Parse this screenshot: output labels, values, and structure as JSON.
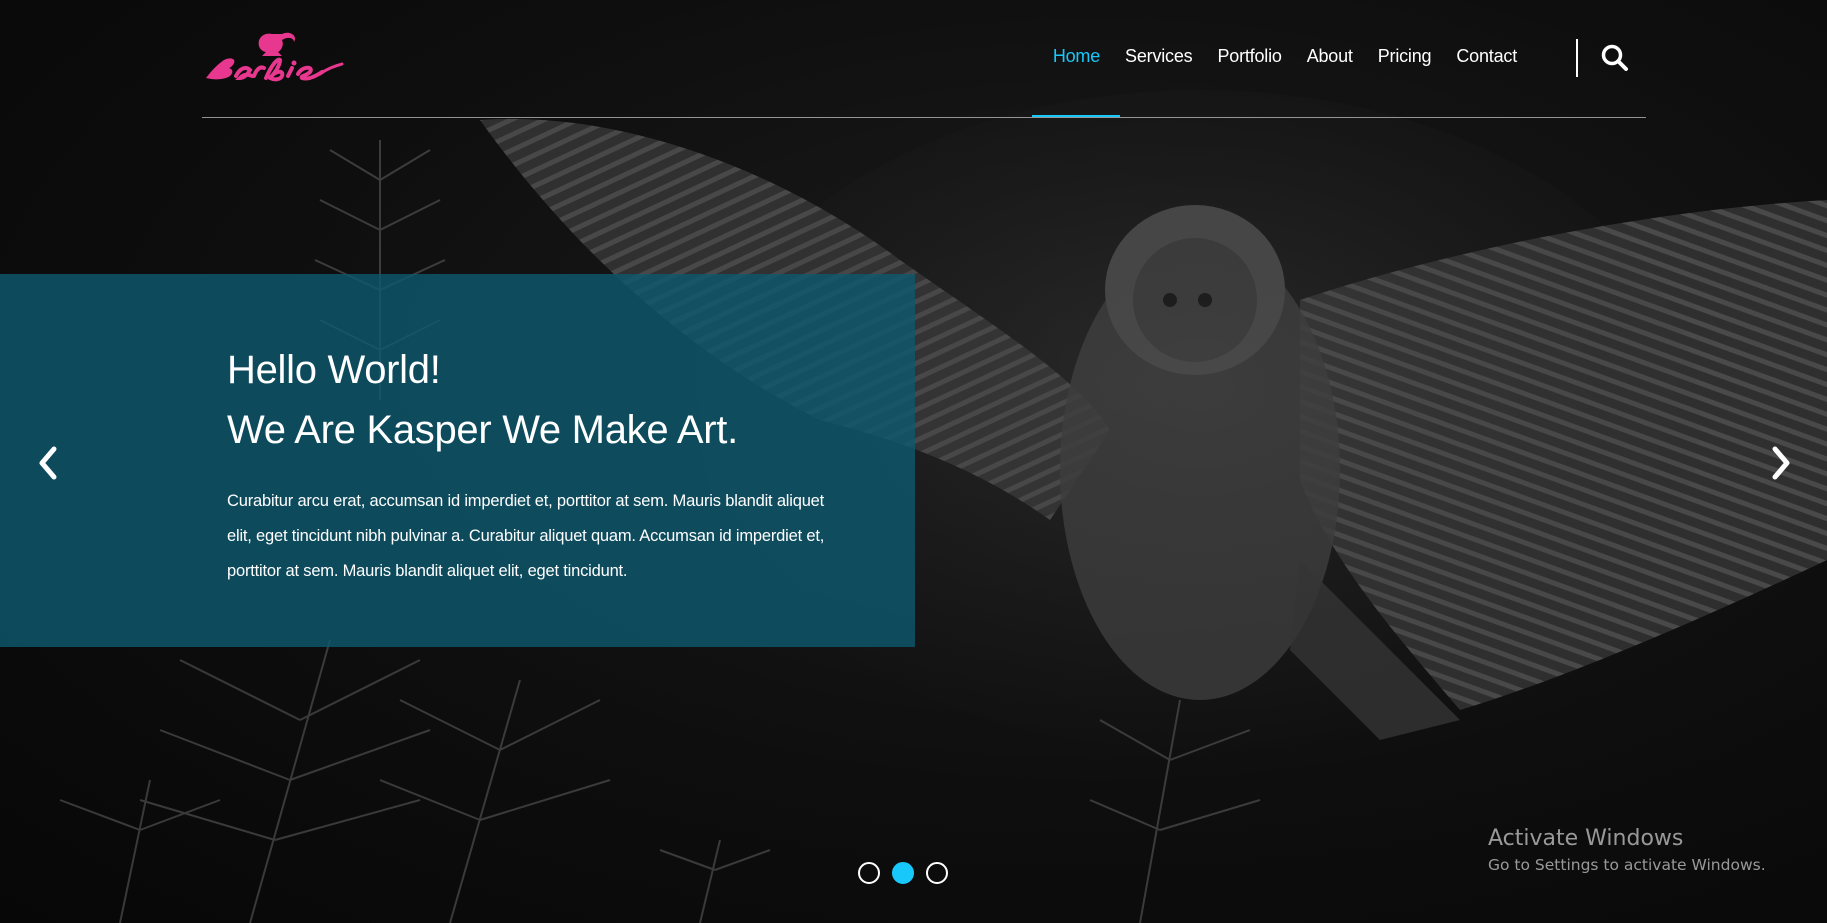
{
  "brand": {
    "logo_text": "Barbie",
    "logo_color": "#e8378f"
  },
  "nav": {
    "items": [
      {
        "label": "Home",
        "active": true
      },
      {
        "label": "Services",
        "active": false
      },
      {
        "label": "Portfolio",
        "active": false
      },
      {
        "label": "About",
        "active": false
      },
      {
        "label": "Pricing",
        "active": false
      },
      {
        "label": "Contact",
        "active": false
      }
    ],
    "search_icon": "search-icon",
    "accent_color": "#19c8fa"
  },
  "slide": {
    "title_line1": "Hello World!",
    "title_line2": "We Are Kasper We Make Art.",
    "text": "Curabitur arcu erat, accumsan id imperdiet et, porttitor at sem. Mauris blandit aliquet elit, eget tincidunt nibh pulvinar a. Curabitur aliquet quam. Accumsan id imperdiet et, porttitor at sem. Mauris blandit aliquet elit, eget tincidunt.",
    "box_color": "#0c586e",
    "prev_icon": "chevron-left-icon",
    "next_icon": "chevron-right-icon"
  },
  "carousel": {
    "dots": [
      {
        "active": false
      },
      {
        "active": true
      },
      {
        "active": false
      }
    ]
  },
  "watermark": {
    "title": "Activate Windows",
    "subtitle": "Go to Settings to activate Windows."
  }
}
